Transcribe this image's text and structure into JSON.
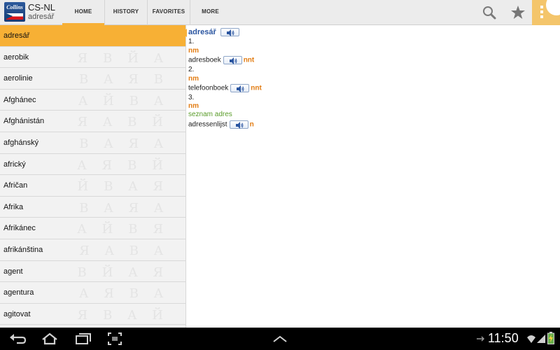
{
  "app": {
    "title": "CS-NL",
    "subtitle": "adresář",
    "logo_text": "Collins"
  },
  "tabs": [
    {
      "label": "HOME",
      "selected": true
    },
    {
      "label": "HISTORY",
      "selected": false
    },
    {
      "label": "FAVORITES",
      "selected": false
    },
    {
      "label": "MORE",
      "selected": false
    }
  ],
  "actions": {
    "search": "search-icon",
    "star": "star-icon",
    "overflow": "overflow-menu-icon"
  },
  "colors": {
    "accent": "#f7b035",
    "headword": "#2a55a0",
    "part_of_speech": "#e27c12",
    "note": "#5a9c2a"
  },
  "word_list": {
    "selected": "adresář",
    "items": [
      "adresář",
      "aerobik",
      "aerolinie",
      "Afghánec",
      "Afghánistán",
      "afghánský",
      "africký",
      "Afričan",
      "Afrika",
      "Afrikánec",
      "afrikánština",
      "agent",
      "agentura",
      "agitovat"
    ]
  },
  "entry": {
    "headword": "adresář",
    "senses": [
      {
        "number": "1.",
        "pos": "nm",
        "translation": "adresboek",
        "gender": "nnt",
        "note": ""
      },
      {
        "number": "2.",
        "pos": "nm",
        "translation": "telefoonboek",
        "gender": "nnt",
        "note": ""
      },
      {
        "number": "3.",
        "pos": "nm",
        "translation": "adressenlijst",
        "gender": "n",
        "note": "seznam adres"
      }
    ]
  },
  "status_bar": {
    "time": "11:50"
  }
}
